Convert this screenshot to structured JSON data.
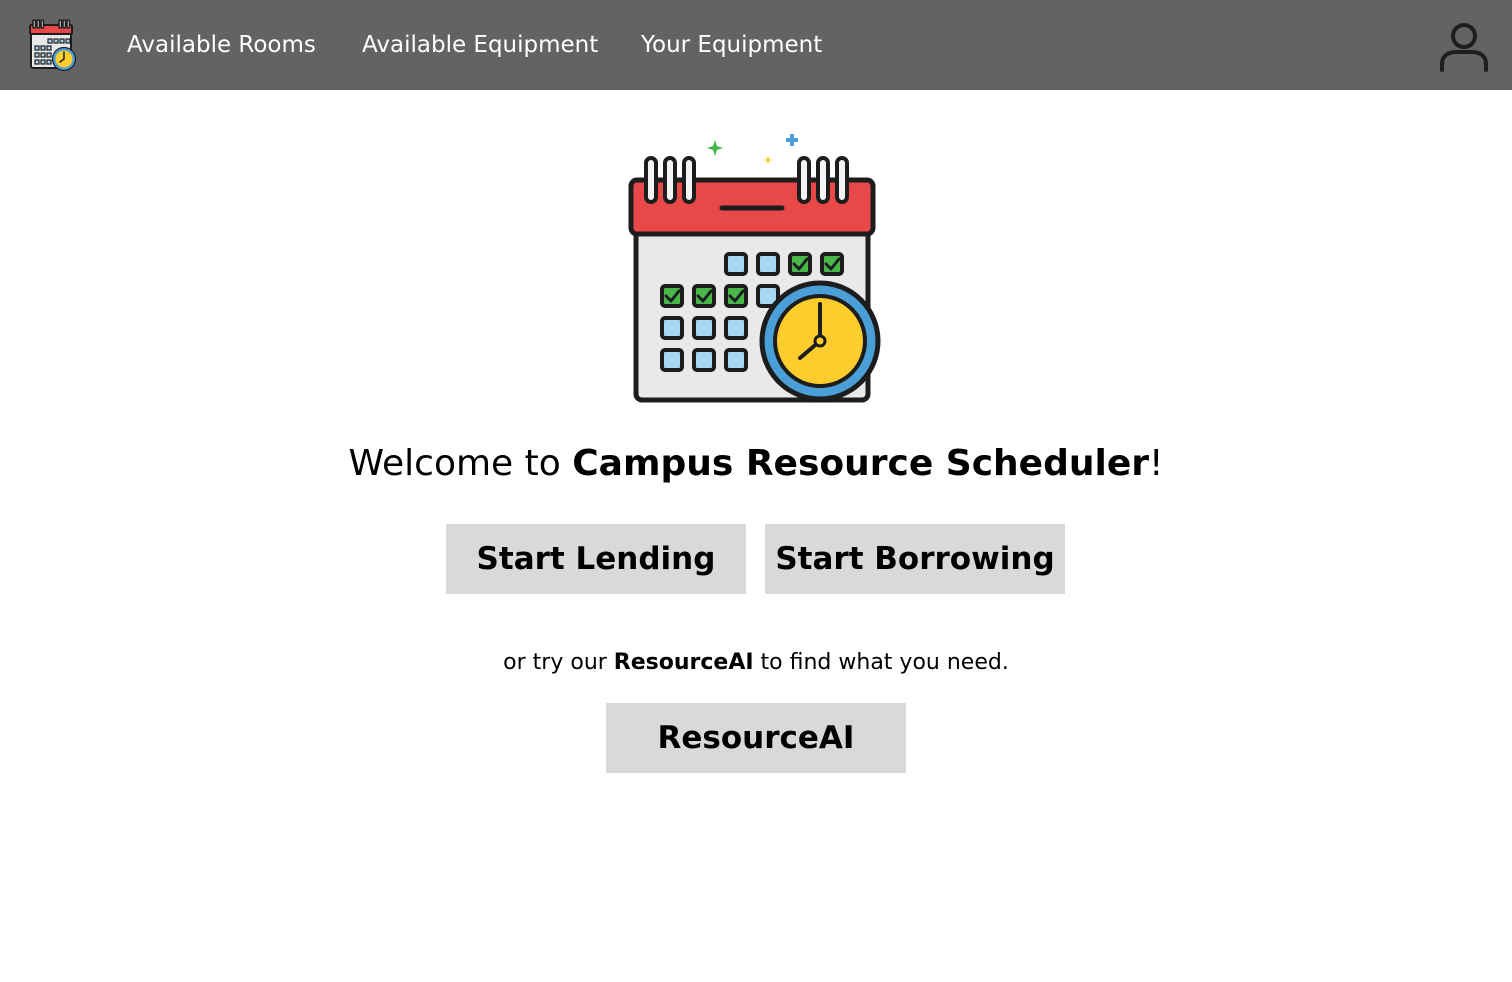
{
  "nav": {
    "items": [
      {
        "label": "Available Rooms"
      },
      {
        "label": "Available Equipment"
      },
      {
        "label": "Your Equipment"
      }
    ],
    "logo_icon": "calendar-clock-icon",
    "user_icon": "user-icon"
  },
  "hero": {
    "icon": "calendar-clock-icon",
    "welcome_prefix": "Welcome to ",
    "app_name": "Campus Resource Scheduler",
    "welcome_suffix": "!"
  },
  "actions": {
    "lend_label": "Start Lending",
    "borrow_label": "Start Borrowing"
  },
  "hint": {
    "prefix": "or try our ",
    "highlight": "ResourceAI",
    "suffix": " to find what you need."
  },
  "ai": {
    "label": "ResourceAI"
  },
  "colors": {
    "topbar": "#636363",
    "button_bg": "#d9d9d9",
    "calendar_red": "#e84848",
    "clock_yellow": "#fdcd2e",
    "clock_ring": "#4aa0d6",
    "check_green": "#49b649",
    "cell_blue": "#a8d8f0"
  }
}
